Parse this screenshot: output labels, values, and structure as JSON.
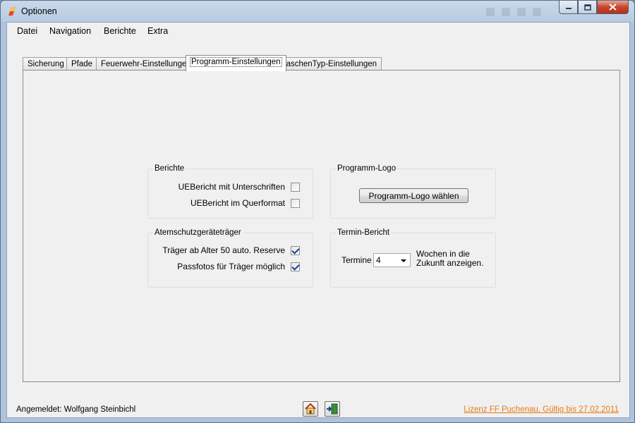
{
  "window": {
    "title": "Optionen",
    "icons": [
      "app-logo-icon",
      "minimize-icon",
      "maximize-icon",
      "close-icon"
    ]
  },
  "menu": [
    "Datei",
    "Navigation",
    "Berichte",
    "Extra"
  ],
  "tabs": [
    {
      "label": "Sicherung",
      "active": false
    },
    {
      "label": "Pfade",
      "active": false
    },
    {
      "label": "Feuerwehr-Einstellungen",
      "active": false
    },
    {
      "label": "Programm-Einstellungen",
      "active": true
    },
    {
      "label": "FlaschenTyp-Einstellungen",
      "active": false
    }
  ],
  "groups": {
    "berichte": {
      "title": "Berichte",
      "options": [
        {
          "label": "UEBericht mit Unterschriften",
          "checked": false
        },
        {
          "label": "UEBericht im Querformat",
          "checked": false
        }
      ]
    },
    "logo": {
      "title": "Programm-Logo",
      "button": "Programm-Logo wählen"
    },
    "atemschutz": {
      "title": "Atemschutzgeräteträger",
      "options": [
        {
          "label": "Träger ab Alter 50 auto. Reserve",
          "checked": true
        },
        {
          "label": "Passfotos für Träger möglich",
          "checked": true
        }
      ]
    },
    "termin": {
      "title": "Termin-Bericht",
      "label": "Termine",
      "value": "4",
      "suffix_line1": "Wochen in die",
      "suffix_line2": "Zukunft anzeigen."
    }
  },
  "status": {
    "user": "Angemeldet: Wolfgang Steinbichl",
    "license": "Lizenz FF Puchenau, Gültig bis 27.02.2011",
    "buttons": [
      "home-icon",
      "exit-door-icon"
    ]
  }
}
